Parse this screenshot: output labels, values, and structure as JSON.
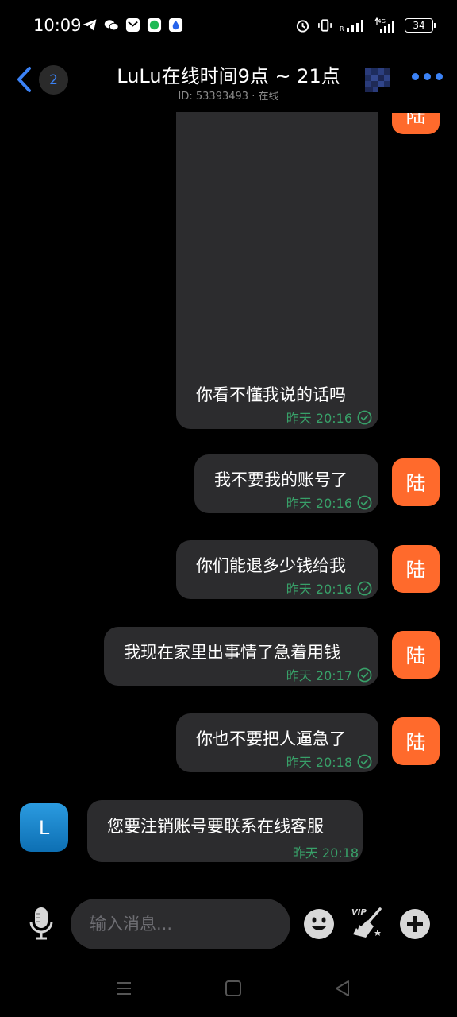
{
  "status_bar": {
    "time": "10:09",
    "battery": "34",
    "network": "4G"
  },
  "header": {
    "unread_count": "2",
    "title": "LuLu在线时间9点 ~ 21点",
    "subtitle": "ID: 53393493 · 在线"
  },
  "messages": [
    {
      "side": "me",
      "text": "你看不懂我说的话吗",
      "time": "昨天 20:16",
      "avatar": "陆"
    },
    {
      "side": "me",
      "text": "我不要我的账号了",
      "time": "昨天 20:16",
      "avatar": "陆"
    },
    {
      "side": "me",
      "text": "你们能退多少钱给我",
      "time": "昨天 20:16",
      "avatar": "陆"
    },
    {
      "side": "me",
      "text": "我现在家里出事情了急着用钱",
      "time": "昨天 20:17",
      "avatar": "陆"
    },
    {
      "side": "me",
      "text": "你也不要把人逼急了",
      "time": "昨天 20:18",
      "avatar": "陆"
    },
    {
      "side": "other",
      "text": "您要注销账号要联系在线客服",
      "time": "昨天 20:18",
      "avatar": "L"
    }
  ],
  "top_partial_avatar": "陆",
  "input": {
    "placeholder": "输入消息..."
  },
  "vip_label": "VIP",
  "colors": {
    "accent_blue": "#3b82f6",
    "bubble_bg": "#2c2c2e",
    "time_green": "#38a169",
    "my_avatar": "#ff6a2c",
    "other_avatar": "#1a85cc"
  }
}
